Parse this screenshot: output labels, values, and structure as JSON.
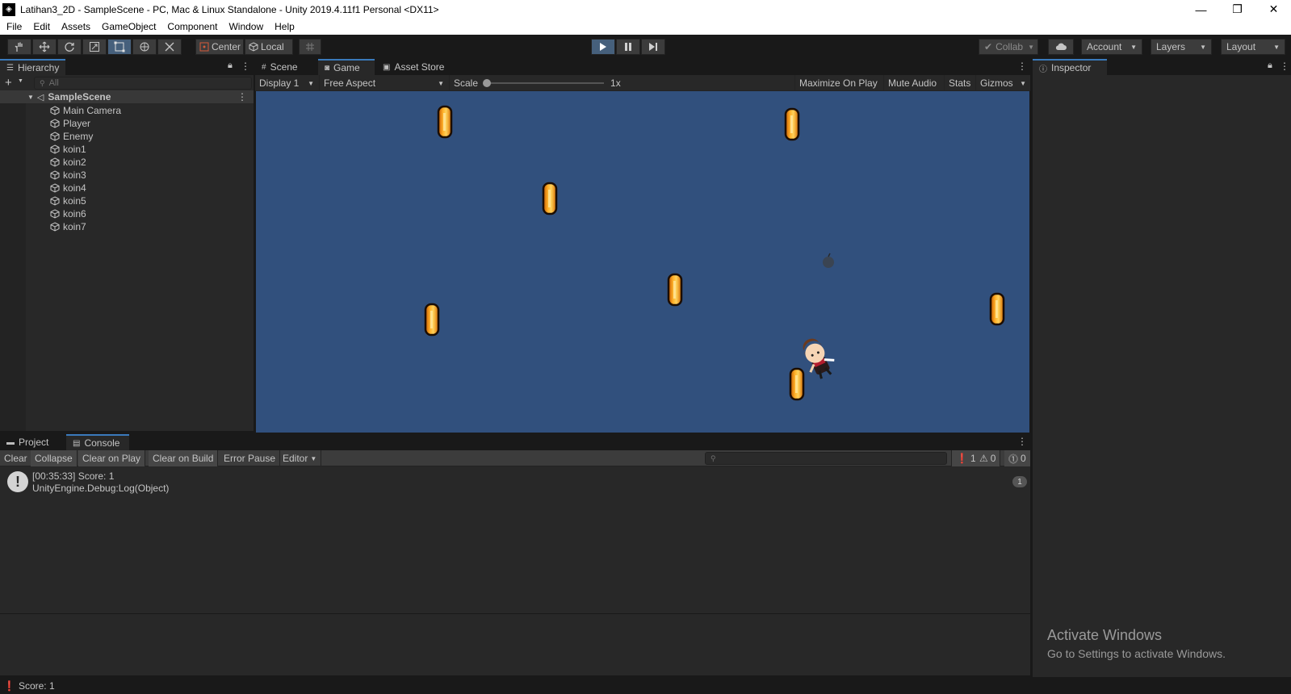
{
  "window": {
    "title": "Latihan3_2D - SampleScene - PC, Mac & Linux Standalone - Unity 2019.4.11f1 Personal <DX11>"
  },
  "menu": [
    "File",
    "Edit",
    "Assets",
    "GameObject",
    "Component",
    "Window",
    "Help"
  ],
  "toolbar": {
    "pivot": "Center",
    "space": "Local",
    "collab": "Collab",
    "account": "Account",
    "layers": "Layers",
    "layout": "Layout"
  },
  "hierarchy": {
    "tab": "Hierarchy",
    "search_placeholder": "All",
    "scene": "SampleScene",
    "items": [
      "Main Camera",
      "Player",
      "Enemy",
      "koin1",
      "koin2",
      "koin3",
      "koin4",
      "koin5",
      "koin6",
      "koin7"
    ]
  },
  "center_tabs": [
    "Scene",
    "Game",
    "Asset Store"
  ],
  "game_toolbar": {
    "display": "Display 1",
    "aspect": "Free Aspect",
    "scale_label": "Scale",
    "scale_value": "1x",
    "maximize": "Maximize On Play",
    "mute": "Mute Audio",
    "stats": "Stats",
    "gizmos": "Gizmos"
  },
  "inspector": {
    "tab": "Inspector"
  },
  "bottom_tabs": [
    "Project",
    "Console"
  ],
  "console": {
    "buttons": [
      "Clear",
      "Collapse",
      "Clear on Play",
      "Clear on Build",
      "Error Pause",
      "Editor"
    ],
    "counts": {
      "log": "1",
      "warn": "0",
      "error": "0"
    },
    "entry": {
      "line1": "[00:35:33] Score: 1",
      "line2": "UnityEngine.Debug:Log(Object)",
      "count": "1"
    }
  },
  "watermark": {
    "title": "Activate Windows",
    "subtitle": "Go to Settings to activate Windows."
  },
  "status": {
    "text": "Score: 1"
  },
  "colors": {
    "game_bg": "#31507d",
    "play_active": "#46607c",
    "panel": "#282828",
    "tab_accent": "#3a79bb"
  }
}
